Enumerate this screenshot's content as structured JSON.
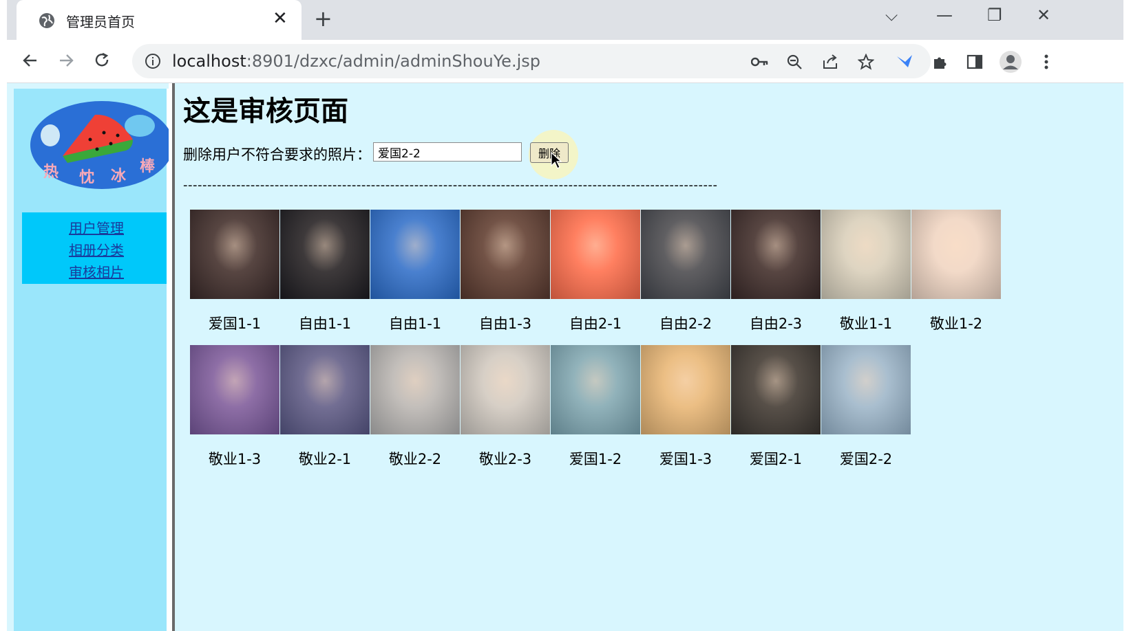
{
  "browser": {
    "tab_title": "管理员首页",
    "url_host": "localhost",
    "url_path": ":8901/dzxc/admin/adminShouYe.jsp"
  },
  "sidebar": {
    "logo_text": "热 忱 冰 棒",
    "links": [
      "用户管理",
      "相册分类",
      "审核相片"
    ]
  },
  "main": {
    "heading": "这是审核页面",
    "delete_label": "删除用户不符合要求的照片：",
    "delete_input_value": "爱国2-2",
    "delete_button": "删除",
    "dashes": "---------------------------------------------------------------------------------------------------------------"
  },
  "photos": [
    {
      "caption": "爱国1-1",
      "color": "#3a2a2a"
    },
    {
      "caption": "自由1-1",
      "color": "#1c1c22"
    },
    {
      "caption": "自由1-1",
      "color": "#2a6fd0"
    },
    {
      "caption": "自由1-3",
      "color": "#5a3a30"
    },
    {
      "caption": "自由2-1",
      "color": "#ff6e4e"
    },
    {
      "caption": "自由2-2",
      "color": "#444850"
    },
    {
      "caption": "自由2-3",
      "color": "#3a2a2a"
    },
    {
      "caption": "敬业1-1",
      "color": "#d8d2c0"
    },
    {
      "caption": "敬业1-2",
      "color": "#f0d8c8"
    },
    {
      "caption": "敬业1-3",
      "color": "#7a5aa0"
    },
    {
      "caption": "敬业2-1",
      "color": "#5a5a8a"
    },
    {
      "caption": "敬业2-2",
      "color": "#b8b8b8"
    },
    {
      "caption": "敬业2-3",
      "color": "#d0ccc6"
    },
    {
      "caption": "爱国1-2",
      "color": "#7eaab8"
    },
    {
      "caption": "爱国1-3",
      "color": "#e8b878"
    },
    {
      "caption": "爱国2-1",
      "color": "#3a3632"
    },
    {
      "caption": "爱国2-2",
      "color": "#9ab8d0"
    }
  ]
}
